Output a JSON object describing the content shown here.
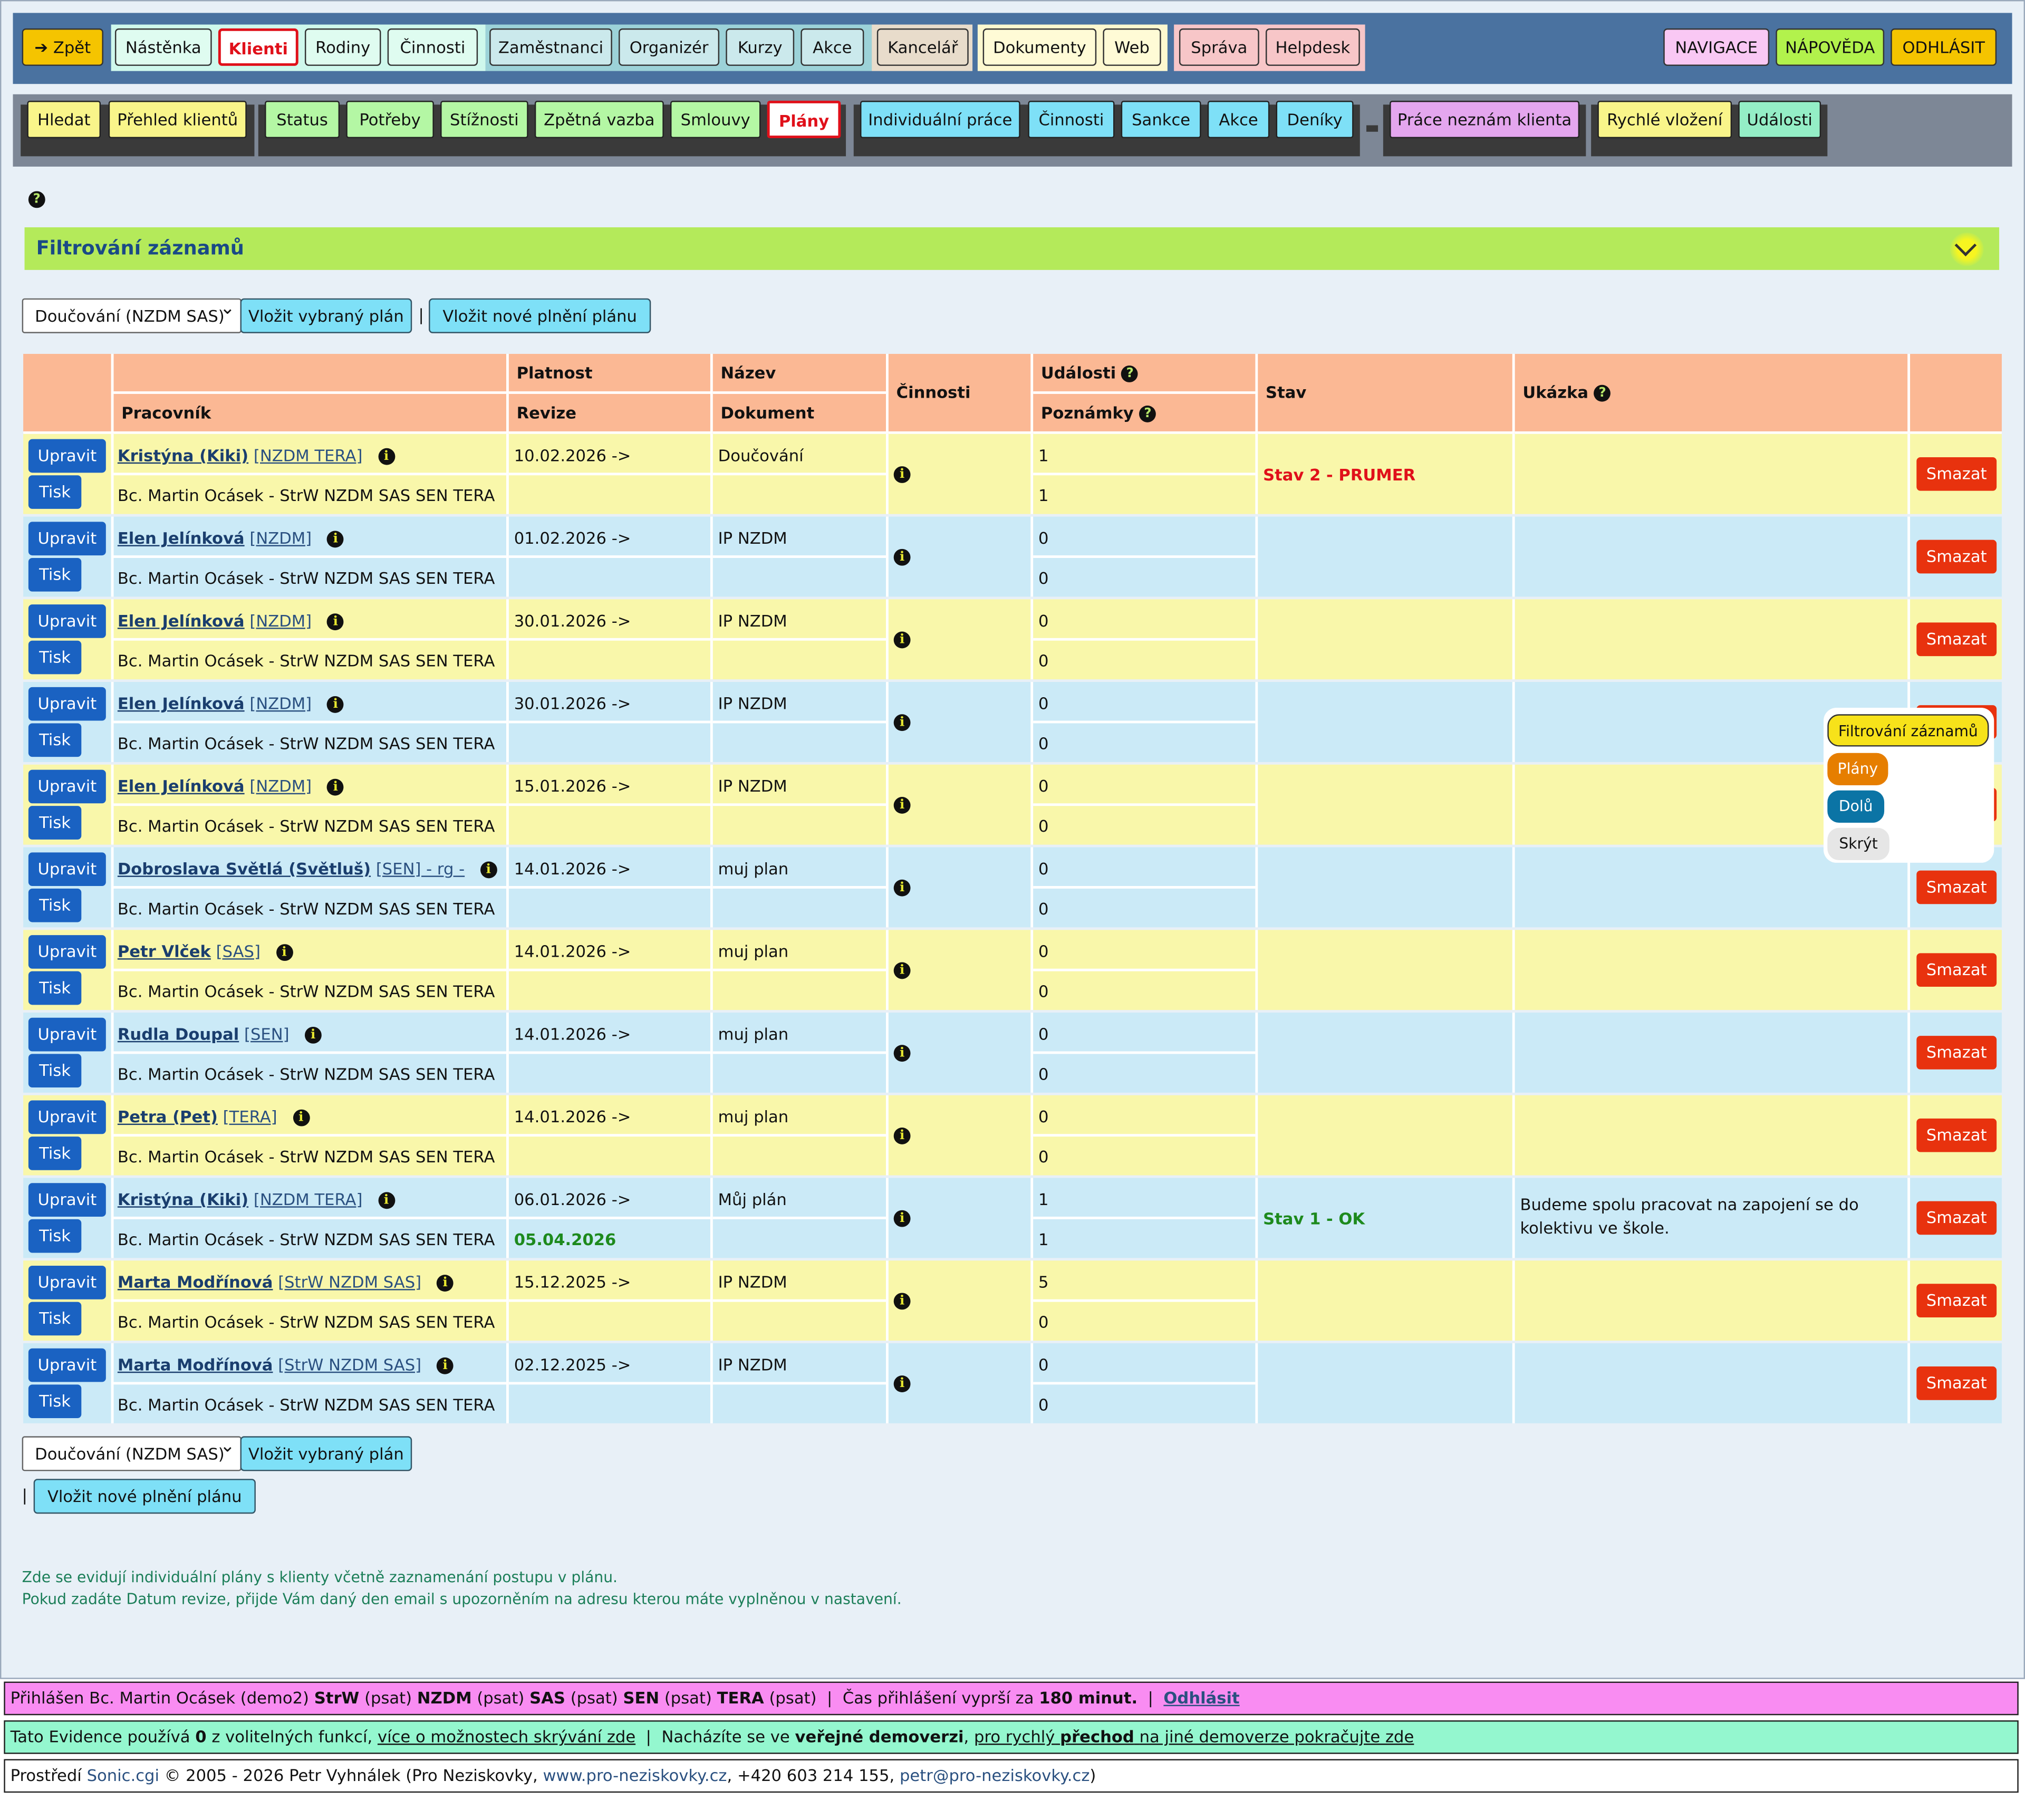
{
  "topnav": {
    "back": "Zpět",
    "items": [
      "Nástěnka",
      "Klienti",
      "Rodiny",
      "Činnosti",
      "Zaměstnanci",
      "Organizér",
      "Kurzy",
      "Akce",
      "Kancelář",
      "Dokumenty",
      "Web",
      "Správa",
      "Helpdesk"
    ],
    "right": [
      "NAVIGACE",
      "NÁPOVĚDA",
      "ODHLÁSIT"
    ]
  },
  "subnav": {
    "items": [
      "Hledat",
      "Přehled klientů",
      "Status",
      "Potřeby",
      "Stížnosti",
      "Zpětná vazba",
      "Smlouvy",
      "Plány",
      "Individuální práce",
      "Činnosti",
      "Sankce",
      "Akce",
      "Deníky",
      "Práce neznám klienta",
      "Rychlé vložení",
      "Události"
    ]
  },
  "filter": {
    "title": "Filtrování záznamů"
  },
  "controls": {
    "plan_select": "Doučování (NZDM SAS)",
    "insert_selected": "Vložit vybraný plán",
    "separator": "|",
    "insert_new": "Vložit nové plnění plánu"
  },
  "table": {
    "headers": {
      "platnost": "Platnost",
      "nazev": "Název",
      "cinnosti": "Činnosti",
      "udalosti": "Události",
      "stav": "Stav",
      "ukazka": "Ukázka",
      "pracovnik": "Pracovník",
      "revize": "Revize",
      "dokument": "Dokument",
      "poznamky": "Poznámky"
    },
    "edit_label": "Upravit",
    "print_label": "Tisk",
    "delete_label": "Smazat",
    "rows": [
      {
        "name": "Kristýna (Kiki)",
        "tag": "[NZDM TERA]",
        "worker": "Bc. Martin Ocásek - StrW NZDM SAS SEN TERA",
        "platnost": "10.02.2026 ->",
        "revize": "",
        "nazev": "Doučování",
        "udalosti": "1",
        "poznamky": "1",
        "stav": "Stav 2 - PRUMER",
        "ukazka": ""
      },
      {
        "name": "Elen Jelínková",
        "tag": "[NZDM]",
        "worker": "Bc. Martin Ocásek - StrW NZDM SAS SEN TERA",
        "platnost": "01.02.2026 ->",
        "revize": "",
        "nazev": "IP NZDM",
        "udalosti": "0",
        "poznamky": "0",
        "stav": "",
        "ukazka": ""
      },
      {
        "name": "Elen Jelínková",
        "tag": "[NZDM]",
        "worker": "Bc. Martin Ocásek - StrW NZDM SAS SEN TERA",
        "platnost": "30.01.2026 ->",
        "revize": "",
        "nazev": "IP NZDM",
        "udalosti": "0",
        "poznamky": "0",
        "stav": "",
        "ukazka": ""
      },
      {
        "name": "Elen Jelínková",
        "tag": "[NZDM]",
        "worker": "Bc. Martin Ocásek - StrW NZDM SAS SEN TERA",
        "platnost": "30.01.2026 ->",
        "revize": "",
        "nazev": "IP NZDM",
        "udalosti": "0",
        "poznamky": "0",
        "stav": "",
        "ukazka": ""
      },
      {
        "name": "Elen Jelínková",
        "tag": "[NZDM]",
        "worker": "Bc. Martin Ocásek - StrW NZDM SAS SEN TERA",
        "platnost": "15.01.2026 ->",
        "revize": "",
        "nazev": "IP NZDM",
        "udalosti": "0",
        "poznamky": "0",
        "stav": "",
        "ukazka": ""
      },
      {
        "name": "Dobroslava Světlá (Světluš)",
        "tag": "[SEN] - rg -",
        "worker": "Bc. Martin Ocásek - StrW NZDM SAS SEN TERA",
        "platnost": "14.01.2026 ->",
        "revize": "",
        "nazev": "muj plan",
        "udalosti": "0",
        "poznamky": "0",
        "stav": "",
        "ukazka": ""
      },
      {
        "name": "Petr Vlček",
        "tag": "[SAS]",
        "worker": "Bc. Martin Ocásek - StrW NZDM SAS SEN TERA",
        "platnost": "14.01.2026 ->",
        "revize": "",
        "nazev": "muj plan",
        "udalosti": "0",
        "poznamky": "0",
        "stav": "",
        "ukazka": ""
      },
      {
        "name": "Rudla Doupal",
        "tag": "[SEN]",
        "worker": "Bc. Martin Ocásek - StrW NZDM SAS SEN TERA",
        "platnost": "14.01.2026 ->",
        "revize": "",
        "nazev": "muj plan",
        "udalosti": "0",
        "poznamky": "0",
        "stav": "",
        "ukazka": ""
      },
      {
        "name": "Petra (Pet)",
        "tag": "[TERA]",
        "worker": "Bc. Martin Ocásek - StrW NZDM SAS SEN TERA",
        "platnost": "14.01.2026 ->",
        "revize": "",
        "nazev": "muj plan",
        "udalosti": "0",
        "poznamky": "0",
        "stav": "",
        "ukazka": ""
      },
      {
        "name": "Kristýna (Kiki)",
        "tag": "[NZDM TERA]",
        "worker": "Bc. Martin Ocásek - StrW NZDM SAS SEN TERA",
        "platnost": "06.01.2026 ->",
        "revize": "05.04.2026",
        "nazev": "Můj plán",
        "udalosti": "1",
        "poznamky": "1",
        "stav": "Stav 1 - OK",
        "ukazka": "Budeme spolu pracovat na zapojení se do kolektivu ve škole."
      },
      {
        "name": "Marta Modřínová",
        "tag": "[StrW NZDM SAS]",
        "worker": "Bc. Martin Ocásek - StrW NZDM SAS SEN TERA",
        "platnost": "15.12.2025 ->",
        "revize": "",
        "nazev": "IP NZDM",
        "udalosti": "5",
        "poznamky": "0",
        "stav": "",
        "ukazka": ""
      },
      {
        "name": "Marta Modřínová",
        "tag": "[StrW NZDM SAS]",
        "worker": "Bc. Martin Ocásek - StrW NZDM SAS SEN TERA",
        "platnost": "02.12.2025 ->",
        "revize": "",
        "nazev": "IP NZDM",
        "udalosti": "0",
        "poznamky": "0",
        "stav": "",
        "ukazka": ""
      }
    ]
  },
  "popup": {
    "items": [
      "Filtrování záznamů",
      "Plány",
      "Dolů",
      "Skrýt"
    ]
  },
  "info": {
    "line1": "Zde se evidují individuální plány s klienty včetně zaznamenání postupu v plánu.",
    "line2": "Pokud zadáte Datum revize, přijde Vám daný den email s upozorněním na adresu kterou máte vyplněnou v nastavení."
  },
  "footer": {
    "login_prefix": "Přihlášen Bc. Martin Ocásek (demo2)",
    "roles": [
      {
        "r": "StrW",
        "p": "(psat)"
      },
      {
        "r": "NZDM",
        "p": "(psat)"
      },
      {
        "r": "SAS",
        "p": "(psat)"
      },
      {
        "r": "SEN",
        "p": "(psat)"
      },
      {
        "r": "TERA",
        "p": "(psat)"
      }
    ],
    "sep": "|",
    "session": "Čas přihlášení vyprší za",
    "session_value": "180 minut.",
    "logout": "Odhlásit",
    "evid_1": "Tato Evidence používá",
    "evid_count": "0",
    "evid_2": "z volitelných funkcí,",
    "evid_link": "více o možnostech skrývání zde",
    "evid_3": "Nacházíte se ve",
    "evid_bold": "veřejné demoverzi",
    "evid_4": ",",
    "evid_link2a": "pro rychlý",
    "evid_link2b": "přechod",
    "evid_link2c": "na jiné demoverze pokračujte zde",
    "copy_1": "Prostředí",
    "copy_sonic": "Sonic.cgi",
    "copy_2": "© 2005 - 2026 Petr Vyhnálek (Pro Neziskovky,",
    "copy_web": "www.pro-neziskovky.cz",
    "copy_3": ", +420 603 214 155,",
    "copy_mail": "petr@pro-neziskovky.cz",
    "copy_4": ")"
  },
  "colors": {
    "header": "#fbb894",
    "row_yellow": "#f9f7aa",
    "row_blue": "#cbeaf7",
    "danger": "#e8320e",
    "primary": "#1a62c2"
  }
}
